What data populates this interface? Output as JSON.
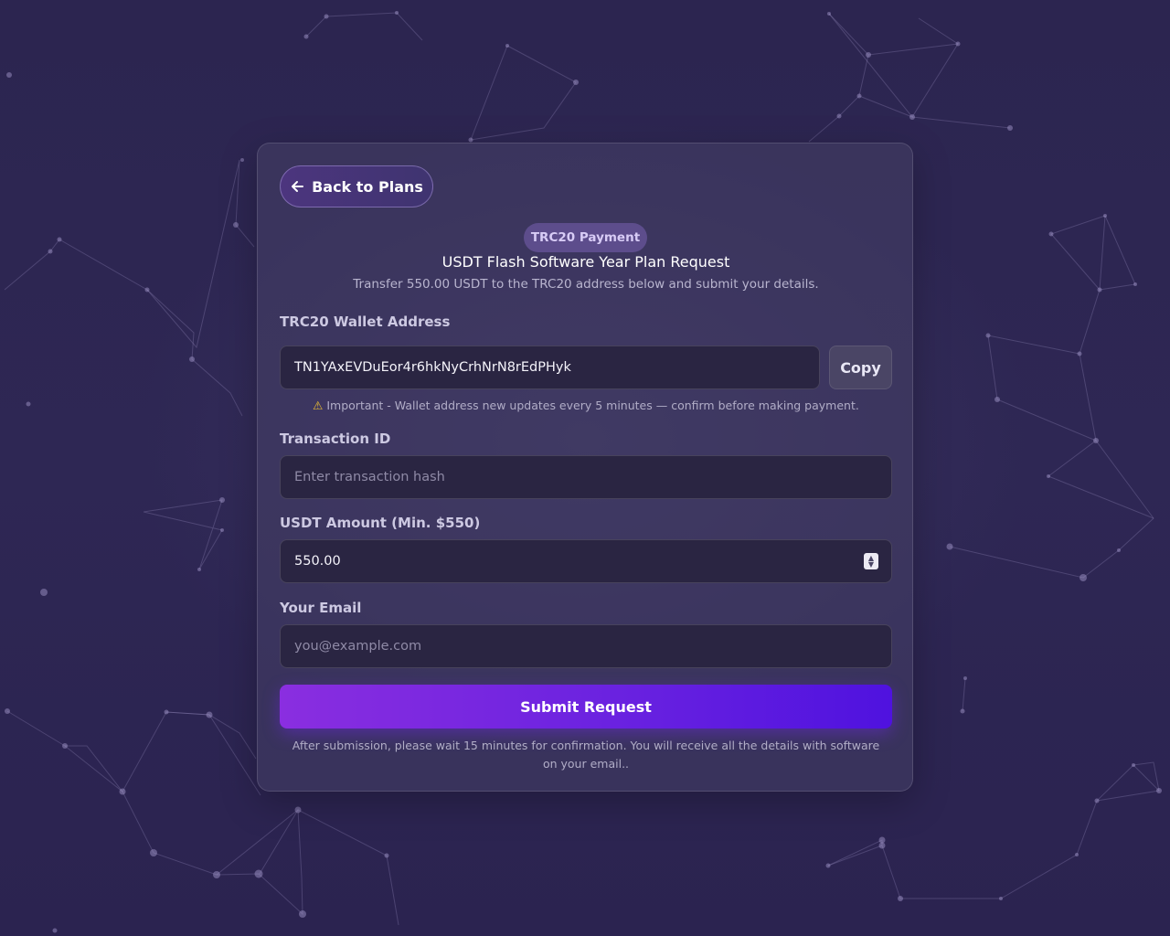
{
  "back_button": {
    "label": "Back to Plans",
    "icon": "arrow-left-icon"
  },
  "header": {
    "badge": "TRC20 Payment",
    "title": "USDT Flash Software Year Plan Request",
    "subtitle": "Transfer 550.00 USDT to the TRC20 address below and submit your details."
  },
  "wallet": {
    "label": "TRC20 Wallet Address",
    "address": "TN1YAxEVDuEor4r6hkNyCrhNrN8rEdPHyk",
    "copy_label": "Copy",
    "note_icon": "warning-icon",
    "note": "Important - Wallet address new updates every 5 minutes — confirm before making payment."
  },
  "transaction": {
    "label": "Transaction ID",
    "placeholder": "Enter transaction hash",
    "value": ""
  },
  "amount": {
    "label": "USDT Amount (Min. $550)",
    "value": "550.00"
  },
  "email": {
    "label": "Your Email",
    "placeholder": "you@example.com",
    "value": ""
  },
  "submit": {
    "label": "Submit Request"
  },
  "footer": {
    "note": "After submission, please wait 15 minutes for confirmation. You will receive all the details with software on your email.."
  },
  "colors": {
    "background": "#2d2652",
    "card": "#464066",
    "accent_start": "#8a2ee0",
    "accent_end": "#4f12df",
    "badge": "#5d4d8c",
    "warning": "#f1c232"
  }
}
